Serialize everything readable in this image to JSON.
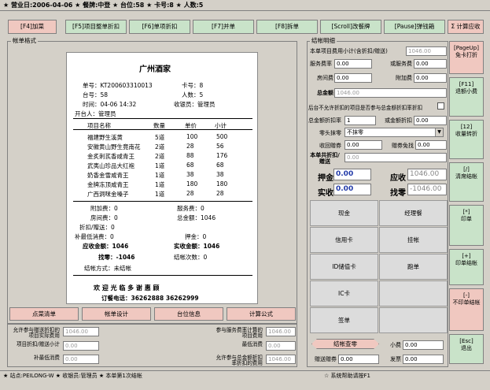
{
  "titlebar": "★ 营业日:2006-04-06 ★ 餐牌:中登 ★ 台位:58 ★ 卡号:8 ★ 人数:5",
  "toolbar": [
    {
      "label": "[F4]加菜",
      "pink": true
    },
    {
      "label": "[F5]项目整单折扣",
      "pink": false
    },
    {
      "label": "[F6]单项折扣",
      "pink": false
    },
    {
      "label": "[F7]并单",
      "pink": false
    },
    {
      "label": "[F8]拆单",
      "pink": false
    },
    {
      "label": "[Scroll]改餐牌",
      "pink": false
    },
    {
      "label": "[Pause]弹钱箱",
      "pink": false
    },
    {
      "label": "Σ 计算应收",
      "pink": true
    }
  ],
  "left_group_title": "帐单格式",
  "receipt": {
    "restaurant": "广州酒家",
    "bill_no": "单号：KT200603310013",
    "card_no": "卡号：8",
    "table_no": "台号：58",
    "persons": "人数：5",
    "time": "时间：04-06 14:32",
    "cashier": "收银员：管理员",
    "opener": "开台人：管理员",
    "header": {
      "name": "项目名称",
      "qty": "数量",
      "price": "单价",
      "subtotal": "小计"
    },
    "items": [
      {
        "name": "福建野生溪黄",
        "qty": "5道",
        "price": "100",
        "subtotal": "500"
      },
      {
        "name": "安徽黄山野生竟南花",
        "qty": "2道",
        "price": "28",
        "subtotal": "56"
      },
      {
        "name": "金炙刺芪香咸青王",
        "qty": "2道",
        "price": "88",
        "subtotal": "176"
      },
      {
        "name": "武夷山珍品大红袍",
        "qty": "1道",
        "price": "68",
        "subtotal": "68"
      },
      {
        "name": "奶香金雪咸青王",
        "qty": "1道",
        "price": "38",
        "subtotal": "38"
      },
      {
        "name": "金牌冻顶咸青王",
        "qty": "1道",
        "price": "180",
        "subtotal": "180"
      },
      {
        "name": "广西洞咪金嗓子",
        "qty": "1道",
        "price": "28",
        "subtotal": "28"
      }
    ],
    "add_fee": "附加费：0",
    "service_fee": "服务费：0",
    "room_fee": "房间费：0",
    "total": "总金额：1046",
    "discount": "折扣/赠送：0",
    "min_charge_left": "补最低消费：0",
    "deposit": "押金：0",
    "receivable": "应收金额：1046",
    "paid": "实收金额：1046",
    "change": "找零：-1046",
    "settle_count": "结帐次数：0",
    "pay_method": "结帐方式：未结帐",
    "welcome": "欢 迎 光 临      多 谢 惠 顾",
    "phone": "订餐电话：36262888     36262999"
  },
  "bottom_buttons": [
    "点菜清单",
    "帐单设计",
    "台位信息",
    "计算公式"
  ],
  "bottom_fields": {
    "left": [
      {
        "label": "允许参与赠送折扣的项目实际费用",
        "value": "1046.00"
      },
      {
        "label": "项目折扣/赠送小计",
        "value": "0.00"
      },
      {
        "label": "补最低消费",
        "value": "0.00"
      }
    ],
    "right": [
      {
        "label": "参与服务费率计算的项目费用",
        "value": "1046.00"
      },
      {
        "label": "最低消费",
        "value": "0.00"
      },
      {
        "label": "允许参与总金额折扣率折扣的费用",
        "value": "1046.00"
      }
    ]
  },
  "right_group_title": "结帐明细",
  "detail": {
    "item_fee_label": "本单项目费用小计(含折扣/赠送)",
    "item_fee": "1046.00",
    "service_rate_label": "服务费率",
    "service_rate": "0.00",
    "or_service_label": "或服务费",
    "or_service": "0.00",
    "room_fee_label": "房间费",
    "room_fee": "0.00",
    "add_fee_label": "附加费",
    "add_fee": "0.00",
    "total_label": "总金额",
    "total": "1046.00",
    "no_discount_label": "后台不允许折扣的项目是否参与总金额折扣率折扣",
    "discount_rate_label": "总金额折扣率",
    "discount_rate": "1",
    "or_discount_label": "或金额折扣",
    "or_discount": "0.00",
    "zero_label": "零头抹零",
    "zero_value": "不抹零",
    "collect_gift_label": "收回赠券",
    "collect_gift": "0.00",
    "gift_free_label": "赠券免找",
    "gift_free": "0.00",
    "discount_total_label": "本单共折扣/赠送",
    "discount_total": "0.00",
    "deposit_label": "押金",
    "deposit": "0.00",
    "receivable_label": "应收",
    "receivable": "1046.00",
    "paid_label": "实收",
    "paid": "0.00",
    "change_label": "找零",
    "change": "-1046.00"
  },
  "pay_methods": [
    [
      "现金",
      "经理餐"
    ],
    [
      "信用卡",
      "挂帐"
    ],
    [
      "ID储值卡",
      "跑单"
    ],
    [
      "IC卡",
      ""
    ],
    [
      "签单",
      ""
    ]
  ],
  "settle_button": "结帐查零",
  "tip_label": "小费",
  "tip": "0.00",
  "gift_coupon_label": "赠送赠券",
  "gift_coupon": "0.00",
  "invoice_label": "发票",
  "invoice": "0.00",
  "side_buttons": [
    {
      "label": "[PageUp]\n免卡打折",
      "pink": true
    },
    {
      "label": "[F11]\n退额小费",
      "pink": false
    },
    {
      "label": "[12]\n收量转折",
      "pink": false
    },
    {
      "label": "[/]\n清席结帐",
      "pink": false
    },
    {
      "label": "[*]\n印单",
      "pink": false
    },
    {
      "label": "[+]\n印单结帐",
      "pink": false
    },
    {
      "label": "[-]\n不印单结帐",
      "pink": true
    },
    {
      "label": "[Esc]\n退出",
      "pink": false
    }
  ],
  "status_left": "★ 站点:PEILONG-W ★ 收银员:管理员 ★ 本单第1次结帐",
  "status_right": "☆ 系统帮助请按F1",
  "colors": {
    "accent_blue": "#223aa8",
    "green_btn": "#c9e3c9",
    "pink_btn": "#f0c8c0"
  }
}
